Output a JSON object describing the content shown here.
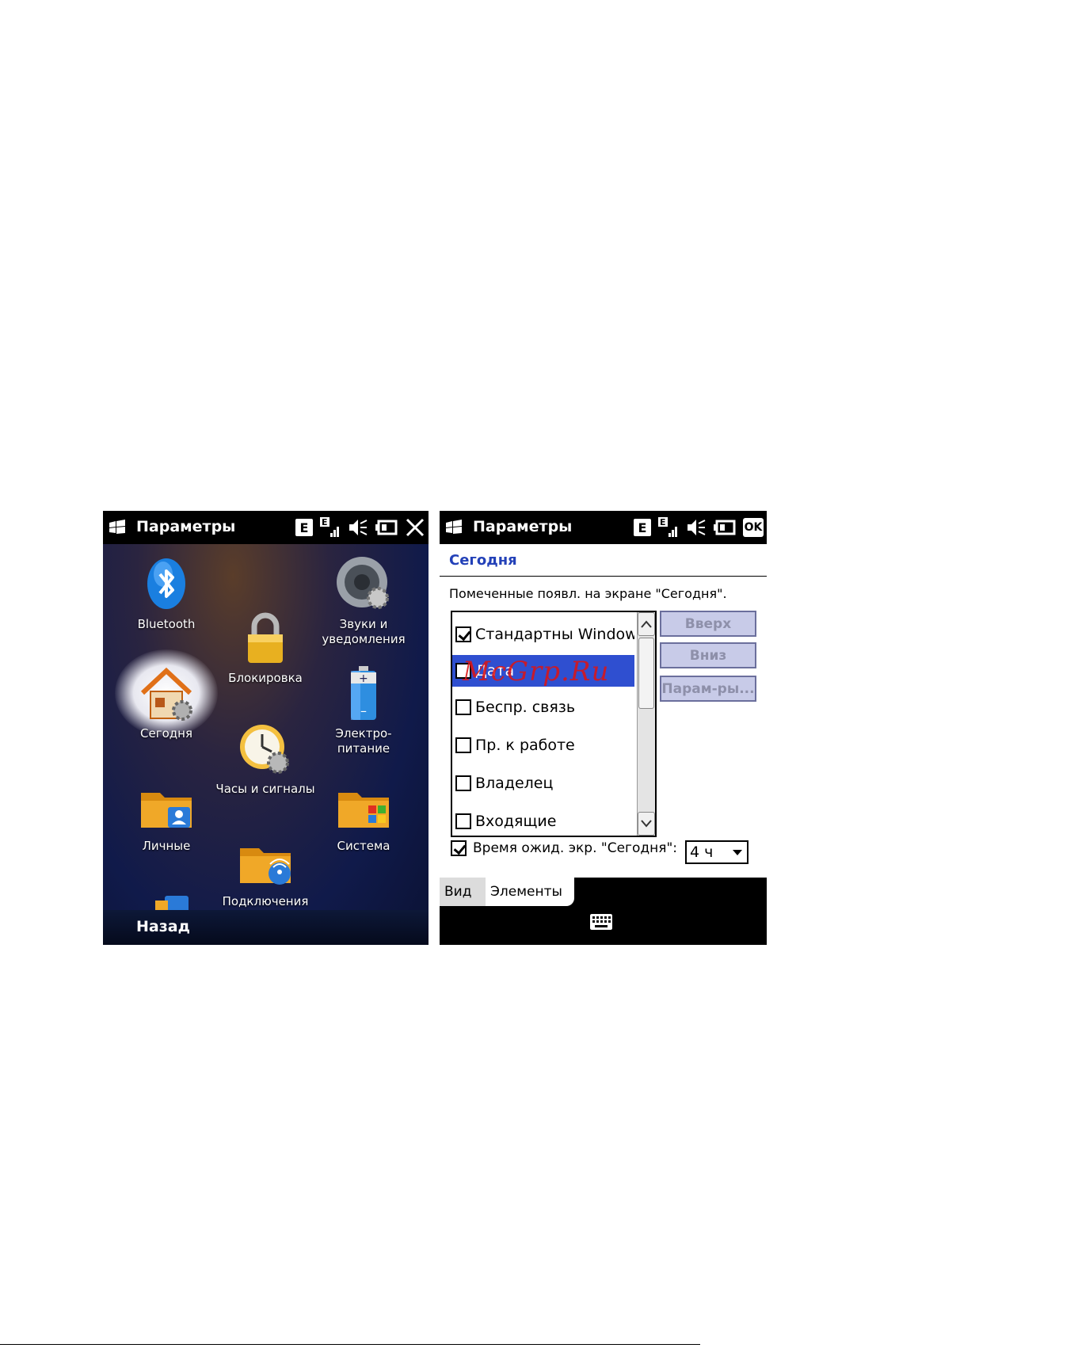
{
  "left": {
    "title": "Параметры",
    "status": {
      "network_letter": "E",
      "signal_letter": "E"
    },
    "tiles": [
      {
        "label": "Bluetooth"
      },
      {
        "label": "Звуки и\nуведомления"
      },
      {
        "label": "Блокировка"
      },
      {
        "label": "Сегодня"
      },
      {
        "label": "Электро-\nпитание"
      },
      {
        "label": "Часы и сигналы"
      },
      {
        "label": "Личные"
      },
      {
        "label": "Система"
      },
      {
        "label": "Подключения"
      }
    ],
    "softkey_left": "Назад"
  },
  "right": {
    "title": "Параметры",
    "status": {
      "network_letter": "E",
      "signal_letter": "E",
      "ok_label": "OK"
    },
    "heading": "Сегодня",
    "description": "Помеченные появл. на экране \"Сегодня\".",
    "items": [
      {
        "label": "Стандартны Window",
        "checked": true
      },
      {
        "label": "Дата",
        "checked": false,
        "selected": true
      },
      {
        "label": "Беспр. связь",
        "checked": false
      },
      {
        "label": "Пр. к работе",
        "checked": false
      },
      {
        "label": "Владелец",
        "checked": false
      },
      {
        "label": "Входящие",
        "checked": false
      }
    ],
    "buttons": {
      "up": "Вверх",
      "down": "Вниз",
      "params": "Парам-ры..."
    },
    "timeout_label": "Время ожид. экр. \"Сегодня\":",
    "timeout_checked": true,
    "timeout_value": "4 ч",
    "tabs": [
      {
        "label": "Вид"
      },
      {
        "label": "Элементы"
      }
    ]
  },
  "watermark": "McGrp.Ru",
  "colors": {
    "heading": "#2341b8",
    "selection": "#2f4fd0",
    "watermark": "#dc1414"
  }
}
